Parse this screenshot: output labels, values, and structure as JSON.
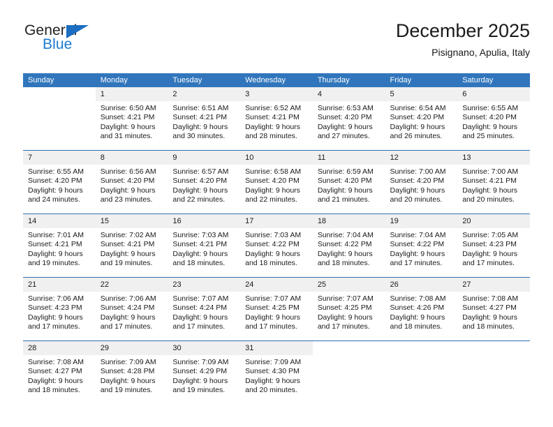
{
  "brand": {
    "name_top": "General",
    "name_bottom": "Blue",
    "accent_color": "#1b7ad1",
    "triangle_color": "#1b6ec2"
  },
  "header": {
    "title": "December 2025",
    "subtitle": "Pisignano, Apulia, Italy"
  },
  "theme": {
    "header_row_bg": "#3176bc",
    "header_row_text": "#ffffff",
    "daynum_bg": "#f0f0f0",
    "week_separator": "#2f6fb0"
  },
  "weekdays": [
    "Sunday",
    "Monday",
    "Tuesday",
    "Wednesday",
    "Thursday",
    "Friday",
    "Saturday"
  ],
  "weeks": [
    [
      {
        "day": "",
        "lines": []
      },
      {
        "day": "1",
        "lines": [
          "Sunrise: 6:50 AM",
          "Sunset: 4:21 PM",
          "Daylight: 9 hours",
          "and 31 minutes."
        ]
      },
      {
        "day": "2",
        "lines": [
          "Sunrise: 6:51 AM",
          "Sunset: 4:21 PM",
          "Daylight: 9 hours",
          "and 30 minutes."
        ]
      },
      {
        "day": "3",
        "lines": [
          "Sunrise: 6:52 AM",
          "Sunset: 4:21 PM",
          "Daylight: 9 hours",
          "and 28 minutes."
        ]
      },
      {
        "day": "4",
        "lines": [
          "Sunrise: 6:53 AM",
          "Sunset: 4:20 PM",
          "Daylight: 9 hours",
          "and 27 minutes."
        ]
      },
      {
        "day": "5",
        "lines": [
          "Sunrise: 6:54 AM",
          "Sunset: 4:20 PM",
          "Daylight: 9 hours",
          "and 26 minutes."
        ]
      },
      {
        "day": "6",
        "lines": [
          "Sunrise: 6:55 AM",
          "Sunset: 4:20 PM",
          "Daylight: 9 hours",
          "and 25 minutes."
        ]
      }
    ],
    [
      {
        "day": "7",
        "lines": [
          "Sunrise: 6:55 AM",
          "Sunset: 4:20 PM",
          "Daylight: 9 hours",
          "and 24 minutes."
        ]
      },
      {
        "day": "8",
        "lines": [
          "Sunrise: 6:56 AM",
          "Sunset: 4:20 PM",
          "Daylight: 9 hours",
          "and 23 minutes."
        ]
      },
      {
        "day": "9",
        "lines": [
          "Sunrise: 6:57 AM",
          "Sunset: 4:20 PM",
          "Daylight: 9 hours",
          "and 22 minutes."
        ]
      },
      {
        "day": "10",
        "lines": [
          "Sunrise: 6:58 AM",
          "Sunset: 4:20 PM",
          "Daylight: 9 hours",
          "and 22 minutes."
        ]
      },
      {
        "day": "11",
        "lines": [
          "Sunrise: 6:59 AM",
          "Sunset: 4:20 PM",
          "Daylight: 9 hours",
          "and 21 minutes."
        ]
      },
      {
        "day": "12",
        "lines": [
          "Sunrise: 7:00 AM",
          "Sunset: 4:20 PM",
          "Daylight: 9 hours",
          "and 20 minutes."
        ]
      },
      {
        "day": "13",
        "lines": [
          "Sunrise: 7:00 AM",
          "Sunset: 4:21 PM",
          "Daylight: 9 hours",
          "and 20 minutes."
        ]
      }
    ],
    [
      {
        "day": "14",
        "lines": [
          "Sunrise: 7:01 AM",
          "Sunset: 4:21 PM",
          "Daylight: 9 hours",
          "and 19 minutes."
        ]
      },
      {
        "day": "15",
        "lines": [
          "Sunrise: 7:02 AM",
          "Sunset: 4:21 PM",
          "Daylight: 9 hours",
          "and 19 minutes."
        ]
      },
      {
        "day": "16",
        "lines": [
          "Sunrise: 7:03 AM",
          "Sunset: 4:21 PM",
          "Daylight: 9 hours",
          "and 18 minutes."
        ]
      },
      {
        "day": "17",
        "lines": [
          "Sunrise: 7:03 AM",
          "Sunset: 4:22 PM",
          "Daylight: 9 hours",
          "and 18 minutes."
        ]
      },
      {
        "day": "18",
        "lines": [
          "Sunrise: 7:04 AM",
          "Sunset: 4:22 PM",
          "Daylight: 9 hours",
          "and 18 minutes."
        ]
      },
      {
        "day": "19",
        "lines": [
          "Sunrise: 7:04 AM",
          "Sunset: 4:22 PM",
          "Daylight: 9 hours",
          "and 17 minutes."
        ]
      },
      {
        "day": "20",
        "lines": [
          "Sunrise: 7:05 AM",
          "Sunset: 4:23 PM",
          "Daylight: 9 hours",
          "and 17 minutes."
        ]
      }
    ],
    [
      {
        "day": "21",
        "lines": [
          "Sunrise: 7:06 AM",
          "Sunset: 4:23 PM",
          "Daylight: 9 hours",
          "and 17 minutes."
        ]
      },
      {
        "day": "22",
        "lines": [
          "Sunrise: 7:06 AM",
          "Sunset: 4:24 PM",
          "Daylight: 9 hours",
          "and 17 minutes."
        ]
      },
      {
        "day": "23",
        "lines": [
          "Sunrise: 7:07 AM",
          "Sunset: 4:24 PM",
          "Daylight: 9 hours",
          "and 17 minutes."
        ]
      },
      {
        "day": "24",
        "lines": [
          "Sunrise: 7:07 AM",
          "Sunset: 4:25 PM",
          "Daylight: 9 hours",
          "and 17 minutes."
        ]
      },
      {
        "day": "25",
        "lines": [
          "Sunrise: 7:07 AM",
          "Sunset: 4:25 PM",
          "Daylight: 9 hours",
          "and 17 minutes."
        ]
      },
      {
        "day": "26",
        "lines": [
          "Sunrise: 7:08 AM",
          "Sunset: 4:26 PM",
          "Daylight: 9 hours",
          "and 18 minutes."
        ]
      },
      {
        "day": "27",
        "lines": [
          "Sunrise: 7:08 AM",
          "Sunset: 4:27 PM",
          "Daylight: 9 hours",
          "and 18 minutes."
        ]
      }
    ],
    [
      {
        "day": "28",
        "lines": [
          "Sunrise: 7:08 AM",
          "Sunset: 4:27 PM",
          "Daylight: 9 hours",
          "and 18 minutes."
        ]
      },
      {
        "day": "29",
        "lines": [
          "Sunrise: 7:09 AM",
          "Sunset: 4:28 PM",
          "Daylight: 9 hours",
          "and 19 minutes."
        ]
      },
      {
        "day": "30",
        "lines": [
          "Sunrise: 7:09 AM",
          "Sunset: 4:29 PM",
          "Daylight: 9 hours",
          "and 19 minutes."
        ]
      },
      {
        "day": "31",
        "lines": [
          "Sunrise: 7:09 AM",
          "Sunset: 4:30 PM",
          "Daylight: 9 hours",
          "and 20 minutes."
        ]
      },
      {
        "day": "",
        "lines": []
      },
      {
        "day": "",
        "lines": []
      },
      {
        "day": "",
        "lines": []
      }
    ]
  ]
}
